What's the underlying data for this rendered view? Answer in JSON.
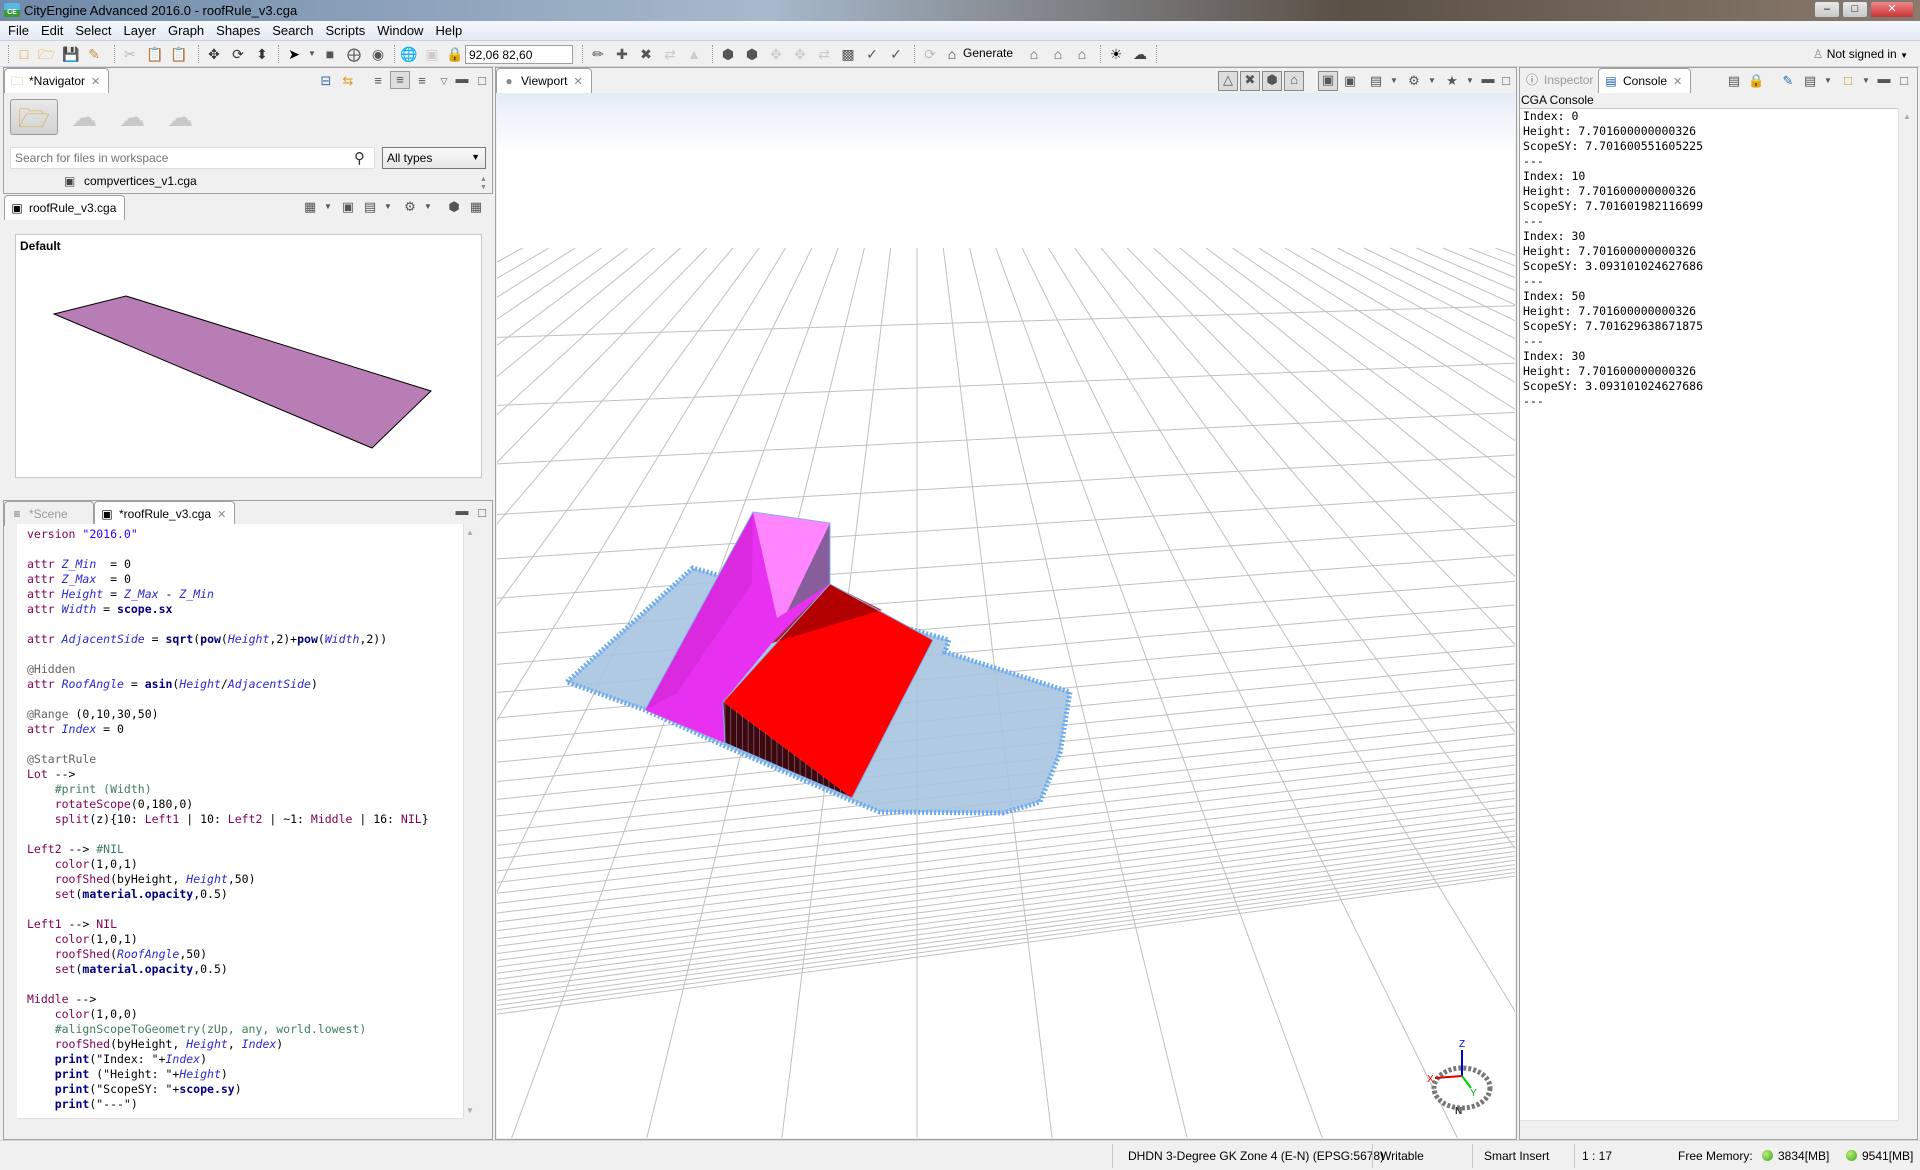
{
  "window": {
    "title": "CityEngine Advanced 2016.0 - roofRule_v3.cga",
    "logo": "CE"
  },
  "menu": [
    "File",
    "Edit",
    "Select",
    "Layer",
    "Graph",
    "Shapes",
    "Search",
    "Scripts",
    "Window",
    "Help"
  ],
  "toolbar": {
    "coordinates": "92,06 82,60",
    "generate_label": "Generate",
    "signin_label": "Not signed in"
  },
  "navigator": {
    "tab_label": "*Navigator",
    "search_placeholder": "Search for files in workspace",
    "type_filter": "All types",
    "files": [
      "compvertices_v1.cga"
    ]
  },
  "preview": {
    "tab_label": "roofRule_v3.cga",
    "style_label": "Default",
    "shape_color": "#b77db4"
  },
  "editor": {
    "tabs": [
      {
        "label": "*Scene",
        "active": false
      },
      {
        "label": "*roofRule_v3.cga",
        "active": true
      }
    ]
  },
  "viewport": {
    "tab_label": "Viewport",
    "axes": {
      "x": "X",
      "y": "Y",
      "z": "Z"
    },
    "colors": {
      "lot": "#a8c4e0",
      "lot_outline": "#6aaaf0",
      "roof_magenta": "#e830f0",
      "roof_red": "#ff0000"
    }
  },
  "right_panel": {
    "tabs": [
      {
        "label": "Inspector",
        "active": false
      },
      {
        "label": "Console",
        "active": true
      }
    ],
    "console_title": "CGA Console",
    "console_lines": [
      "Index: 0",
      "Height: 7.701600000000326",
      "ScopeSY: 7.701600551605225",
      "---",
      "Index: 10",
      "Height: 7.701600000000326",
      "ScopeSY: 7.701601982116699",
      "---",
      "Index: 30",
      "Height: 7.701600000000326",
      "ScopeSY: 3.093101024627686",
      "---",
      "Index: 50",
      "Height: 7.701600000000326",
      "ScopeSY: 7.701629638671875",
      "---",
      "Index: 30",
      "Height: 7.701600000000326",
      "ScopeSY: 3.093101024627686",
      "---"
    ]
  },
  "statusbar": {
    "crs": "DHDN 3-Degree GK Zone 4 (E-N) (EPSG:5678)",
    "mode": "Writable",
    "insert_mode": "Smart Insert",
    "cursor_pos": "1 : 17",
    "memory_label": "Free Memory:",
    "memory_1": "3834[MB]",
    "memory_2": "9541[MB]"
  },
  "code": [
    [
      [
        "kw",
        "version "
      ],
      [
        "st",
        "\"2016.0\""
      ]
    ],
    [],
    [
      [
        "kw",
        "attr "
      ],
      [
        "at",
        "Z_Min"
      ],
      [
        "",
        "  = 0"
      ]
    ],
    [
      [
        "kw",
        "attr "
      ],
      [
        "at",
        "Z_Max"
      ],
      [
        "",
        "  = 0"
      ]
    ],
    [
      [
        "kw",
        "attr "
      ],
      [
        "at",
        "Height"
      ],
      [
        "",
        " = "
      ],
      [
        "at",
        "Z_Max"
      ],
      [
        "",
        " - "
      ],
      [
        "at",
        "Z_Min"
      ]
    ],
    [
      [
        "kw",
        "attr "
      ],
      [
        "at",
        "Width"
      ],
      [
        "",
        " = "
      ],
      [
        "bf",
        "scope.sx"
      ]
    ],
    [],
    [
      [
        "kw",
        "attr "
      ],
      [
        "at",
        "AdjacentSide"
      ],
      [
        "",
        " = "
      ],
      [
        "bf",
        "sqrt"
      ],
      [
        "",
        "("
      ],
      [
        "bf",
        "pow"
      ],
      [
        "",
        "("
      ],
      [
        "at",
        "Height"
      ],
      [
        "",
        ",2)+"
      ],
      [
        "bf",
        "pow"
      ],
      [
        "",
        "("
      ],
      [
        "at",
        "Width"
      ],
      [
        "",
        ",2))"
      ]
    ],
    [],
    [
      [
        "an",
        "@Hidden"
      ]
    ],
    [
      [
        "kw",
        "attr "
      ],
      [
        "at",
        "RoofAngle"
      ],
      [
        "",
        " = "
      ],
      [
        "bf",
        "asin"
      ],
      [
        "",
        "("
      ],
      [
        "at",
        "Height"
      ],
      [
        "",
        "/"
      ],
      [
        "at",
        "AdjacentSide"
      ],
      [
        "",
        ")"
      ]
    ],
    [],
    [
      [
        "an",
        "@Range"
      ],
      [
        "",
        " (0,10,30,50)"
      ]
    ],
    [
      [
        "kw",
        "attr "
      ],
      [
        "at",
        "Index"
      ],
      [
        "",
        " = 0"
      ]
    ],
    [],
    [
      [
        "an",
        "@StartRule"
      ]
    ],
    [
      [
        "rl",
        "Lot"
      ],
      [
        "",
        " -->"
      ]
    ],
    [
      [
        "cm",
        "    #print (Width)"
      ]
    ],
    [
      [
        "rl",
        "    rotateScope"
      ],
      [
        "",
        "(0,180,0)"
      ]
    ],
    [
      [
        "rl",
        "    split"
      ],
      [
        "",
        "(z){10: "
      ],
      [
        "rl",
        "Left1"
      ],
      [
        "",
        " | 10: "
      ],
      [
        "rl",
        "Left2"
      ],
      [
        "",
        " | ~1: "
      ],
      [
        "rl",
        "Middle"
      ],
      [
        "",
        " | 16: "
      ],
      [
        "kw",
        "NIL"
      ],
      [
        "",
        "}"
      ]
    ],
    [],
    [
      [
        "rl",
        "Left2"
      ],
      [
        "",
        " --> "
      ],
      [
        "cm",
        "#NIL"
      ]
    ],
    [
      [
        "rl",
        "    color"
      ],
      [
        "",
        "(1,0,1)"
      ]
    ],
    [
      [
        "rl",
        "    roofShed"
      ],
      [
        "",
        "(byHeight, "
      ],
      [
        "at",
        "Height"
      ],
      [
        "",
        ",50)"
      ]
    ],
    [
      [
        "rl",
        "    set"
      ],
      [
        "",
        "("
      ],
      [
        "bf",
        "material.opacity"
      ],
      [
        "",
        ",0.5)"
      ]
    ],
    [],
    [
      [
        "rl",
        "Left1"
      ],
      [
        "",
        " --> "
      ],
      [
        "kw",
        "NIL"
      ]
    ],
    [
      [
        "rl",
        "    color"
      ],
      [
        "",
        "(1,0,1)"
      ]
    ],
    [
      [
        "rl",
        "    roofShed"
      ],
      [
        "",
        "("
      ],
      [
        "at",
        "RoofAngle"
      ],
      [
        "",
        ",50)"
      ]
    ],
    [
      [
        "rl",
        "    set"
      ],
      [
        "",
        "("
      ],
      [
        "bf",
        "material.opacity"
      ],
      [
        "",
        ",0.5)"
      ]
    ],
    [],
    [
      [
        "rl",
        "Middle"
      ],
      [
        "",
        " -->"
      ]
    ],
    [
      [
        "rl",
        "    color"
      ],
      [
        "",
        "(1,0,0)"
      ]
    ],
    [
      [
        "cm",
        "    #alignScopeToGeometry(zUp, any, world.lowest)"
      ]
    ],
    [
      [
        "rl",
        "    roofShed"
      ],
      [
        "",
        "(byHeight, "
      ],
      [
        "at",
        "Height"
      ],
      [
        "",
        ", "
      ],
      [
        "at",
        "Index"
      ],
      [
        "",
        ")"
      ]
    ],
    [
      [
        "bf",
        "    print"
      ],
      [
        "",
        "(\"Index: \"+"
      ],
      [
        "at",
        "Index"
      ],
      [
        "",
        ")"
      ]
    ],
    [
      [
        "bf",
        "    print"
      ],
      [
        "",
        " (\"Height: \"+"
      ],
      [
        "at",
        "Height"
      ],
      [
        "",
        ")"
      ]
    ],
    [
      [
        "bf",
        "    print"
      ],
      [
        "",
        "(\"ScopeSY: \"+"
      ],
      [
        "bf",
        "scope.sy"
      ],
      [
        "",
        ")"
      ]
    ],
    [
      [
        "bf",
        "    print"
      ],
      [
        "",
        "(\"---\")"
      ]
    ]
  ]
}
